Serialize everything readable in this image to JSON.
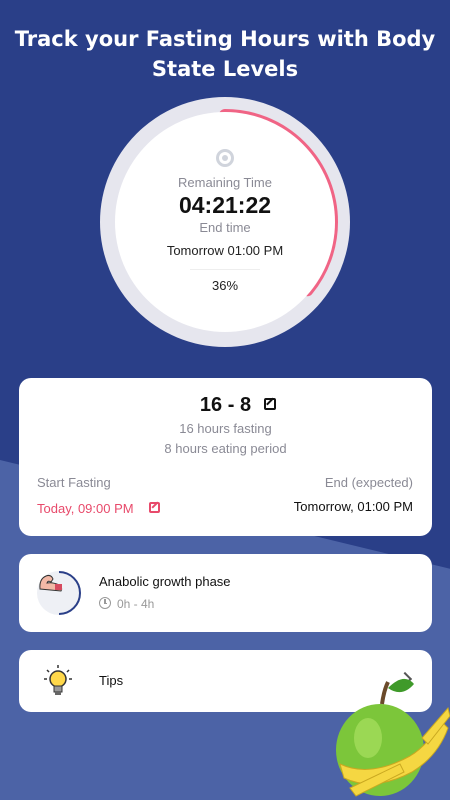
{
  "header": {
    "line1": "Track your Fasting Hours with Body",
    "line2": "State Levels"
  },
  "timer": {
    "remaining_label": "Remaining Time",
    "remaining_time": "04:21:22",
    "end_label": "End time",
    "end_time": "Tomorrow 01:00 PM",
    "progress_text": "36%",
    "progress": 0.36,
    "progress_color": "#f06485",
    "state_icon": "body-state-icon"
  },
  "plan": {
    "title": "16 - 8",
    "fasting_text": "16 hours fasting",
    "eating_text": "8 hours eating period",
    "start_label": "Start Fasting",
    "start_value": "Today, 09:00 PM",
    "end_label": "End (expected)",
    "end_value": "Tomorrow, 01:00 PM"
  },
  "phase": {
    "title": "Anabolic growth phase",
    "range": "0h - 4h",
    "icon": "flexed-arm-icon",
    "progress_color": "#2a3f88"
  },
  "tips": {
    "label": "Tips",
    "icon": "lightbulb-icon"
  },
  "colors": {
    "background": "#2a3f88",
    "accent_pink": "#e84a6b",
    "card": "#ffffff"
  }
}
